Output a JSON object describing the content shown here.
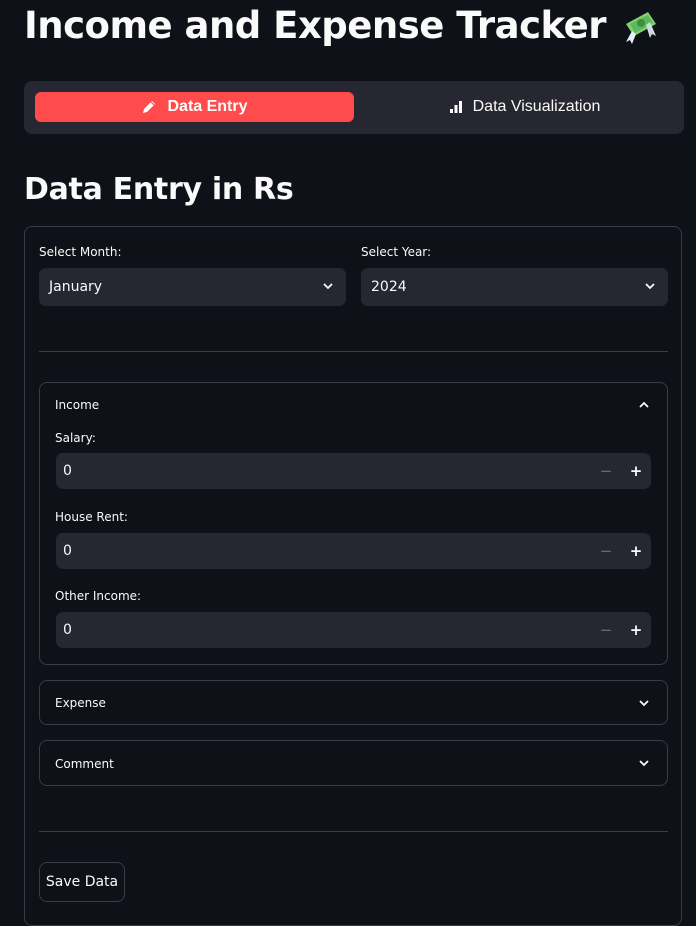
{
  "app": {
    "title": "Income and Expense Tracker",
    "title_icon": "money-with-wings-icon",
    "accent_color": "#ff4b4b"
  },
  "nav": {
    "tabs": [
      {
        "label": "Data Entry",
        "icon": "pencil-icon",
        "active": true
      },
      {
        "label": "Data Visualization",
        "icon": "bar-chart-icon",
        "active": false
      }
    ]
  },
  "section": {
    "heading": "Data Entry in Rs"
  },
  "form": {
    "month": {
      "label": "Select Month:",
      "value": "January"
    },
    "year": {
      "label": "Select Year:",
      "value": "2024"
    },
    "income": {
      "title": "Income",
      "expanded": true,
      "fields": [
        {
          "label": "Salary:",
          "value": "0"
        },
        {
          "label": "House Rent:",
          "value": "0"
        },
        {
          "label": "Other Income:",
          "value": "0"
        }
      ]
    },
    "expense": {
      "title": "Expense",
      "expanded": false
    },
    "comment": {
      "title": "Comment",
      "expanded": false
    },
    "save_label": "Save Data"
  }
}
